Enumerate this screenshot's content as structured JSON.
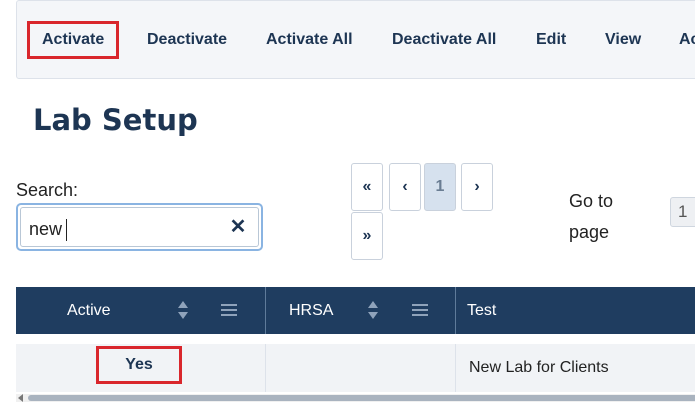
{
  "toolbar": {
    "buttons": [
      {
        "label": "Activate"
      },
      {
        "label": "Deactivate"
      },
      {
        "label": "Activate All"
      },
      {
        "label": "Deactivate All"
      },
      {
        "label": "Edit"
      },
      {
        "label": "View"
      },
      {
        "label": "Ac"
      }
    ]
  },
  "page": {
    "title": "Lab Setup"
  },
  "search": {
    "label": "Search:",
    "value": "new",
    "clear_glyph": "✕"
  },
  "pagination": {
    "first": "«",
    "prev": "‹",
    "current": "1",
    "next": "›",
    "last": "»",
    "goto_label_1": "Go to",
    "goto_label_2": "page",
    "goto_value": "1"
  },
  "table": {
    "columns": [
      {
        "label": "Active"
      },
      {
        "label": "HRSA"
      },
      {
        "label": "Test"
      }
    ],
    "rows": [
      {
        "active": "Yes",
        "hrsa": "",
        "test": "New Lab for Clients"
      }
    ]
  },
  "colors": {
    "header_bg": "#1f3d60",
    "highlight": "#d9262c",
    "text": "#1d3553"
  }
}
